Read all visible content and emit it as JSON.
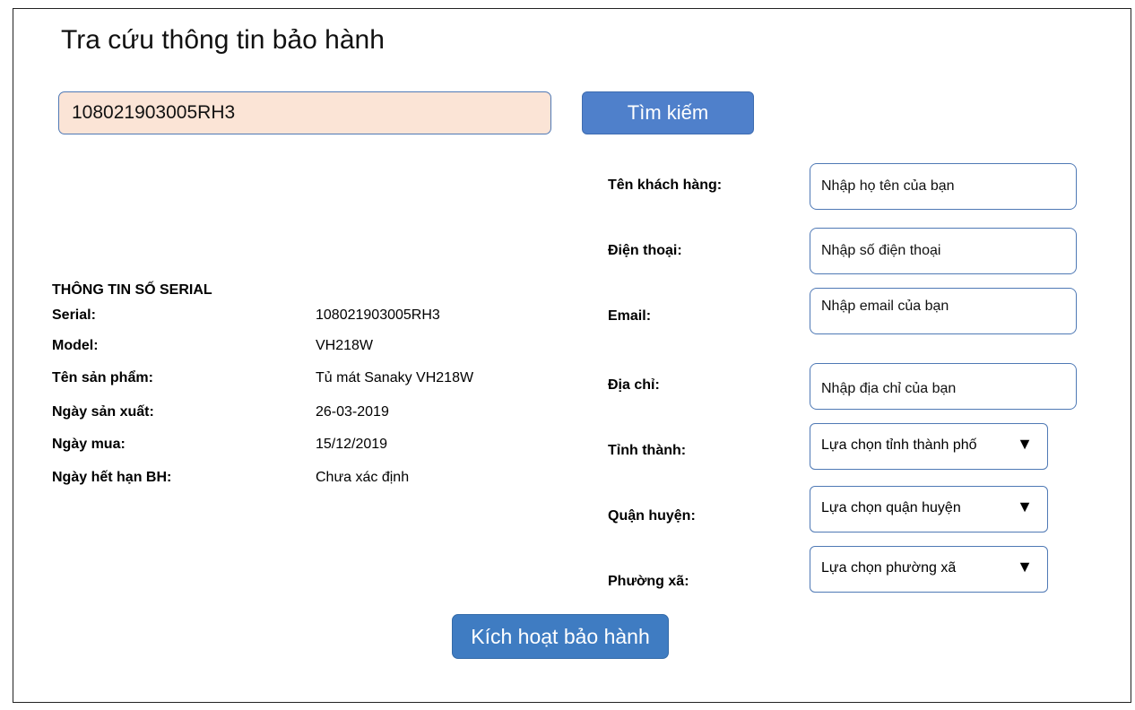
{
  "header": {
    "title": "Tra cứu thông tin bảo hành"
  },
  "search": {
    "value": "108021903005RH3",
    "button_label": "Tìm kiếm"
  },
  "serial_info": {
    "heading": "THÔNG TIN SỐ SERIAL",
    "rows": [
      {
        "label": "Serial:",
        "value": "108021903005RH3"
      },
      {
        "label": "Model:",
        "value": "VH218W"
      },
      {
        "label": "Tên sản phẩm:",
        "value": "Tủ mát Sanaky VH218W"
      },
      {
        "label": "Ngày sản xuất:",
        "value": "26-03-2019"
      },
      {
        "label": "Ngày mua:",
        "value": "15/12/2019"
      },
      {
        "label": "Ngày hết hạn BH:",
        "value": "Chưa xác định"
      }
    ]
  },
  "form": {
    "name": {
      "label": "Tên khách hàng:",
      "placeholder": "Nhập họ tên của bạn"
    },
    "phone": {
      "label": "Điện thoại:",
      "placeholder": "Nhập số điện thoại"
    },
    "email": {
      "label": "Email:",
      "placeholder": "Nhập email của bạn"
    },
    "address": {
      "label": "Địa chỉ:",
      "placeholder": "Nhập địa chỉ của bạn"
    },
    "province": {
      "label": "Tỉnh thành:",
      "selected": "Lựa chọn tỉnh thành phố",
      "caret": "▼"
    },
    "district": {
      "label": "Quận huyện:",
      "selected": "Lựa chọn quận huyện",
      "caret": "▼"
    },
    "ward": {
      "label": "Phường xã:",
      "selected": "Lựa chọn phường xã",
      "caret": "▼"
    }
  },
  "activate": {
    "button_label": "Kích hoạt bảo hành"
  },
  "colors": {
    "search_bg": "#fbe4d6",
    "button_blue": "#4f80cb",
    "border_blue": "#4f79b5"
  }
}
